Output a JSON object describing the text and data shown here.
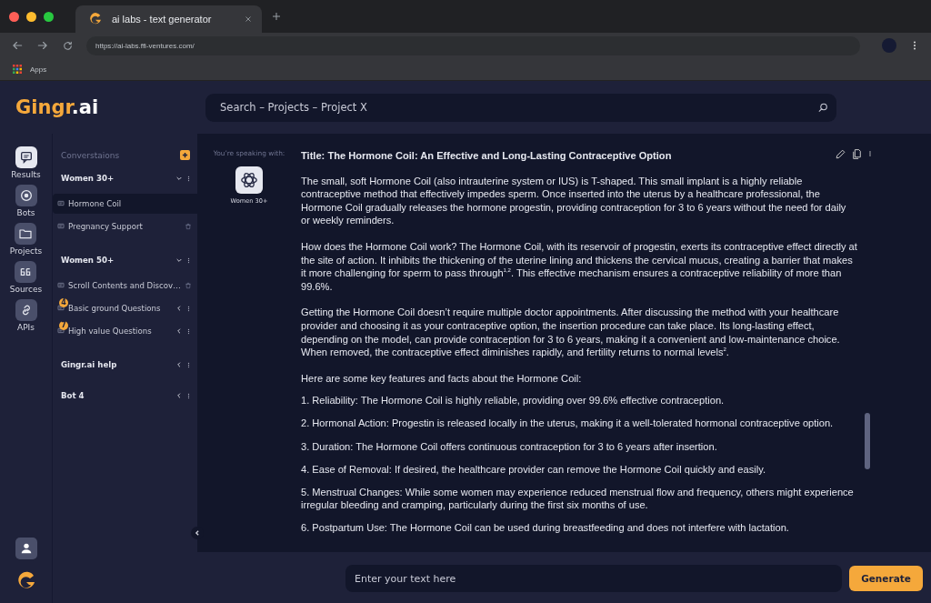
{
  "browser": {
    "tab_title": "ai labs - text generator",
    "url": "https://ai-labs.ffi-ventures.com/",
    "bookmarks": [
      "Apps"
    ]
  },
  "header": {
    "logo_brand": "Gingr",
    "logo_suffix": ".ai",
    "search": {
      "value": "Search – Projects – Project X"
    }
  },
  "nav": {
    "items": [
      {
        "label": "Results",
        "selected": true
      },
      {
        "label": "Bots",
        "selected": false
      },
      {
        "label": "Projects",
        "selected": false
      },
      {
        "label": "Sources",
        "selected": false
      },
      {
        "label": "APIs",
        "selected": false
      }
    ]
  },
  "conversations": {
    "title": "Converstaions",
    "groups": [
      {
        "name": "Women 30+",
        "expanded": true,
        "items": [
          {
            "kind": "chat",
            "label": "Hormone Coil",
            "selected": true,
            "deletable": false
          },
          {
            "kind": "chat",
            "label": "Pregnancy Support",
            "selected": false,
            "deletable": true
          }
        ]
      },
      {
        "name": "Women 50+",
        "expanded": true,
        "items": [
          {
            "kind": "chat",
            "label": "Scroll Contents and Discov…",
            "selected": false,
            "deletable": true
          },
          {
            "kind": "folder",
            "label": "Basic ground Questions",
            "badge": "4",
            "selected": false
          },
          {
            "kind": "folder",
            "label": "High value Questions",
            "badge": "7",
            "selected": false
          }
        ]
      },
      {
        "name": "Gingr.ai help",
        "expanded": false
      },
      {
        "name": "Bot 4",
        "expanded": false
      }
    ]
  },
  "speaker": {
    "label": "You’re speaking with:",
    "bot_name": "Women 30+"
  },
  "article": {
    "title": "Title: The Hormone Coil: An Effective and Long-Lasting Contraceptive Option",
    "paragraphs": [
      "The small, soft Hormone Coil (also intrauterine system or IUS) is T-shaped. This small implant is a highly reliable contraceptive method that effectively impedes sperm. Once inserted into the uterus by a healthcare professional, the Hormone Coil gradually releases the hormone progestin, providing contraception for 3 to 6 years without the need for daily or weekly reminders.",
      "How does the Hormone Coil work? The Hormone Coil, with its reservoir of progestin, exerts its contraceptive effect directly at the site of action. It inhibits the thickening of the uterine lining and thickens the cervical mucus, creating a barrier that makes it more challenging for sperm to pass through$^{1,2}$. This effective mechanism ensures a contraceptive reliability of more than 99.6%.",
      "Getting the Hormone Coil doesn’t require multiple doctor appointments. After discussing the method with your healthcare provider and choosing it as your contraceptive option, the insertion procedure can take place. Its long-lasting effect, depending on the model, can provide contraception for 3 to 6 years, making it a convenient and low-maintenance choice. When removed, the contraceptive effect diminishes rapidly, and fertility returns to normal levels$^{2}$."
    ],
    "list_intro": "Here are some key features and facts about the Hormone Coil:",
    "list": [
      "1. Reliability: The Hormone Coil is highly reliable, providing over 99.6% effective contraception.",
      "2. Hormonal Action: Progestin is released locally in the uterus, making it a well-tolerated hormonal contraceptive option.",
      "3. Duration: The Hormone Coil offers continuous contraception for 3 to 6 years after insertion.",
      "4. Ease of Removal: If desired, the healthcare provider can remove the Hormone Coil quickly and easily.",
      "5. Menstrual Changes: While some women may experience reduced menstrual flow and frequency, others might experience irregular bleeding and cramping, particularly during  the first six months of use.",
      "6. Postpartum Use: The Hormone Coil can be used during breastfeeding and does not interfere with lactation."
    ]
  },
  "composer": {
    "placeholder": "Enter your text here",
    "button": "Generate"
  }
}
